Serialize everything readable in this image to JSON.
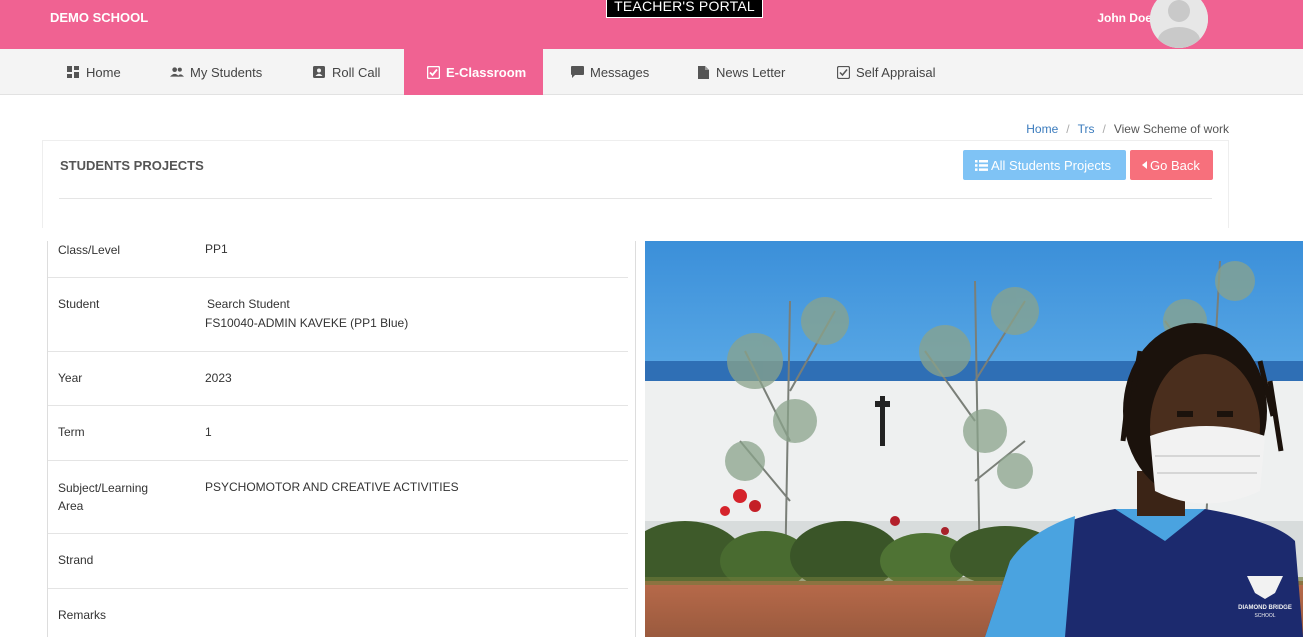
{
  "header": {
    "brand": "DEMO SCHOOL",
    "portal_title": "TEACHER'S PORTAL",
    "user_name": "John Doe",
    "caret": "▾",
    "color_accent": "#f06292"
  },
  "nav": {
    "items": [
      {
        "label": "Home",
        "icon": "dashboard-icon"
      },
      {
        "label": "My Students",
        "icon": "people-icon"
      },
      {
        "label": "Roll Call",
        "icon": "contact-card-icon"
      },
      {
        "label": "E-Classroom",
        "icon": "checkbox-icon",
        "active": true
      },
      {
        "label": "Messages",
        "icon": "message-icon"
      },
      {
        "label": "News Letter",
        "icon": "document-icon"
      },
      {
        "label": "Self Appraisal",
        "icon": "checkbox-outline-icon"
      }
    ]
  },
  "breadcrumb": {
    "items": [
      "Home",
      "Trs",
      "View Scheme of work"
    ],
    "separator": "/"
  },
  "panel": {
    "title": "STUDENTS PROJECTS",
    "all_projects_label": "All Students Projects",
    "go_back_label": "Go Back",
    "info_color": "#7fc3f5",
    "danger_color": "#f7707c"
  },
  "details": {
    "class_level": {
      "label": "Class/Level",
      "value": "PP1"
    },
    "student": {
      "label": "Student",
      "search_text": "Search Student",
      "value": "FS10040-ADMIN KAVEKE (PP1 Blue)"
    },
    "year": {
      "label": "Year",
      "value": "2023"
    },
    "term": {
      "label": "Term",
      "value": "1"
    },
    "subject": {
      "label_line1": "Subject/Learning",
      "label_line2": "Area",
      "value": "PSYCHOMOTOR AND CREATIVE ACTIVITIES"
    },
    "strand": {
      "label": "Strand",
      "value": ""
    },
    "remarks": {
      "label": "Remarks",
      "value": ""
    }
  },
  "photo": {
    "badge_line1": "DIAMOND BRIDGE",
    "badge_line2": "SCHOOL"
  }
}
